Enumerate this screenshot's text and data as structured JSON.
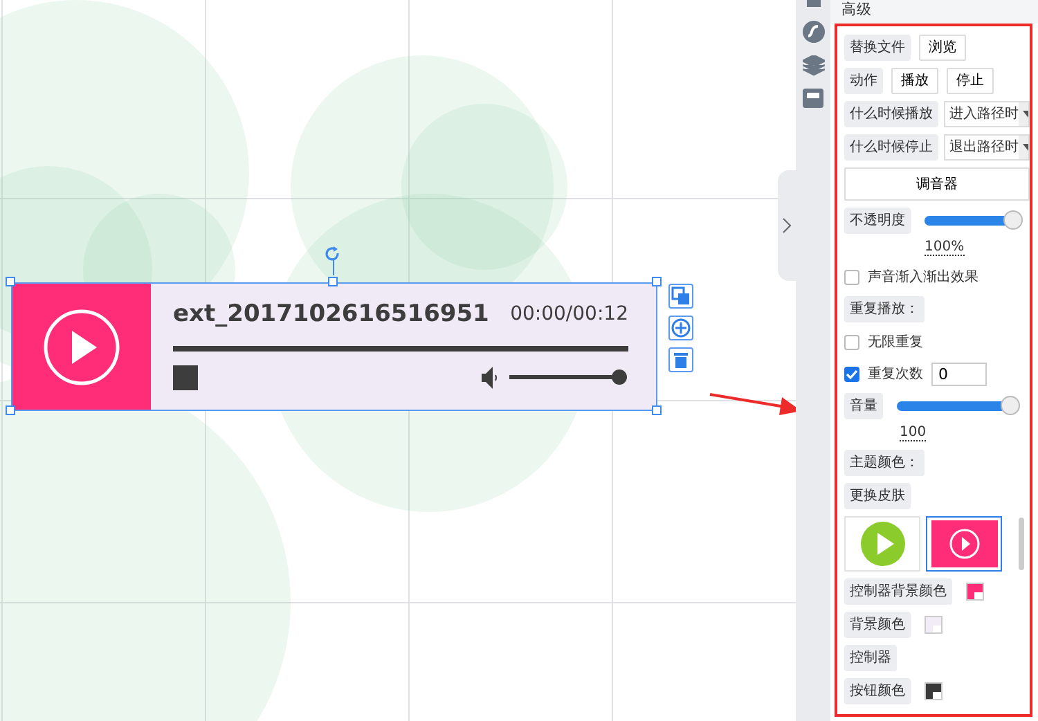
{
  "player": {
    "title": "ext_2017102616516951",
    "time": "00:00/00:12",
    "progress": {
      "level": 0
    },
    "volume": {
      "level": 1.0
    }
  },
  "panel": {
    "title": "高级",
    "rows": [
      {
        "kind": "buttons",
        "label": "替换文件",
        "buttons": [
          "浏览"
        ]
      },
      {
        "kind": "buttons",
        "label": "动作",
        "buttons": [
          "播放",
          "停止"
        ]
      },
      {
        "kind": "select",
        "label": "什么时候播放",
        "value": "进入路径时"
      },
      {
        "kind": "select",
        "label": "什么时候停止",
        "value": "退出路径时"
      },
      {
        "kind": "wide_button",
        "label": "调音器"
      },
      {
        "kind": "slider",
        "label": "不透明度",
        "level": 1.0,
        "reading": "100%"
      },
      {
        "kind": "checkbox",
        "label": "声音渐入渐出效果",
        "checked": false
      },
      {
        "kind": "heading",
        "label": "重复播放："
      },
      {
        "kind": "checkbox",
        "label": "无限重复",
        "checked": false
      },
      {
        "kind": "checkbox",
        "label": "重复次数",
        "checked": true,
        "value": "0"
      },
      {
        "kind": "slider",
        "label": "音量",
        "level": 1.0,
        "reading": "100"
      },
      {
        "kind": "heading",
        "label": "主题颜色："
      },
      {
        "kind": "heading",
        "label": "更换皮肤"
      },
      {
        "kind": "skins",
        "items": [
          {
            "kind": "green",
            "selected": false
          },
          {
            "kind": "pink",
            "selected": true
          }
        ]
      },
      {
        "kind": "color",
        "label": "控制器背景颜色",
        "color": "#ff2d78"
      },
      {
        "kind": "color",
        "label": "背景颜色",
        "color": "#f1ecf6"
      },
      {
        "kind": "color",
        "label": "控制器",
        "color": null
      },
      {
        "kind": "color",
        "label": "按钮颜色",
        "color": "#3a3a3a"
      }
    ]
  }
}
